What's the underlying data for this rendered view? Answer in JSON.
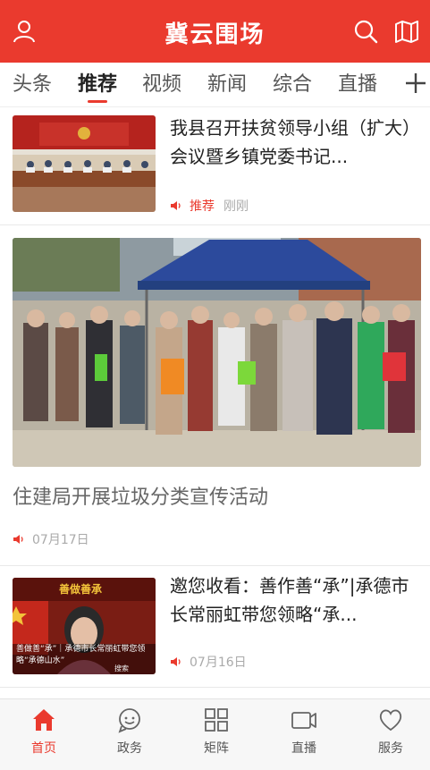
{
  "header": {
    "title": "冀云围场",
    "user_icon": "user-icon",
    "search_icon": "search-icon",
    "map_icon": "map-icon"
  },
  "tabs": [
    {
      "label": "头条"
    },
    {
      "label": "推荐",
      "active": true
    },
    {
      "label": "视频"
    },
    {
      "label": "新闻"
    },
    {
      "label": "综合"
    },
    {
      "label": "直播"
    }
  ],
  "feed": [
    {
      "title": "我县召开扶贫领导小组（扩大）会议暨乡镇党委书记...",
      "tag": "推荐",
      "time": "刚刚"
    },
    {
      "title": "住建局开展垃圾分类宣传活动",
      "time": "07月17日"
    },
    {
      "title": "邀您收看：善作善“承”|承德市长常丽虹带您领略“承...",
      "time": "07月16日",
      "thumb_brand": "善做善承",
      "thumb_caption": "善做善“承”｜承德市长常丽虹带您领略“承德山水”",
      "thumb_corner": "搜索"
    }
  ],
  "tabbar": [
    {
      "label": "首页",
      "icon": "home-icon",
      "active": true
    },
    {
      "label": "政务",
      "icon": "chat-icon"
    },
    {
      "label": "矩阵",
      "icon": "grid-icon"
    },
    {
      "label": "直播",
      "icon": "video-icon"
    },
    {
      "label": "服务",
      "icon": "heart-icon"
    }
  ],
  "colors": {
    "brand": "#ea3a2e",
    "tabbar_bg": "#f7f7f7"
  }
}
